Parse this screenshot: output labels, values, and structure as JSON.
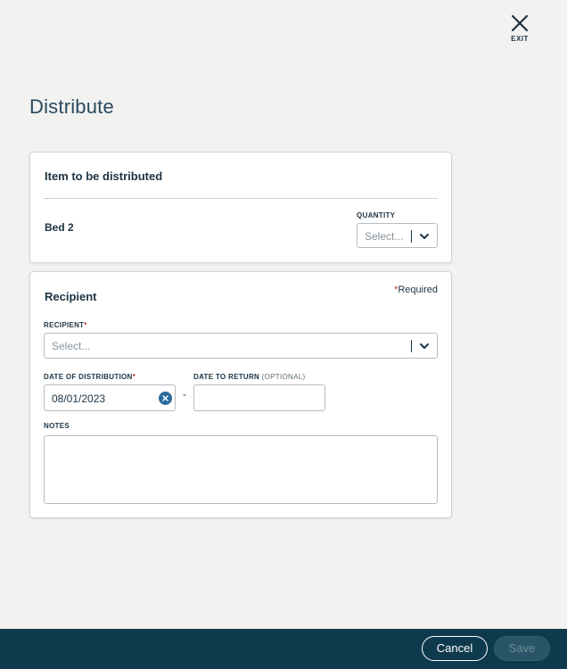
{
  "header": {
    "exit_label": "EXIT"
  },
  "page": {
    "title": "Distribute"
  },
  "item_card": {
    "title": "Item to be distributed",
    "item_name": "Bed 2",
    "quantity_label": "QUANTITY",
    "quantity_placeholder": "Select..."
  },
  "recipient_card": {
    "title": "Recipient",
    "required_star": "*",
    "required_note": "Required",
    "recipient_label": "RECIPIENT",
    "recipient_placeholder": "Select...",
    "date_of_distribution_label": "DATE OF DISTRIBUTION",
    "date_of_distribution_value": "08/01/2023",
    "range_separator": "-",
    "date_to_return_label": "DATE TO RETURN",
    "date_to_return_optional": "(OPTIONAL)",
    "date_to_return_value": "",
    "notes_label": "NOTES",
    "notes_value": ""
  },
  "footer": {
    "cancel_label": "Cancel",
    "save_label": "Save",
    "save_enabled": false
  },
  "colors": {
    "background": "#f2f2f1",
    "footer": "#0f3a4d",
    "accent": "#2c6a9c",
    "required": "#c0392b"
  }
}
